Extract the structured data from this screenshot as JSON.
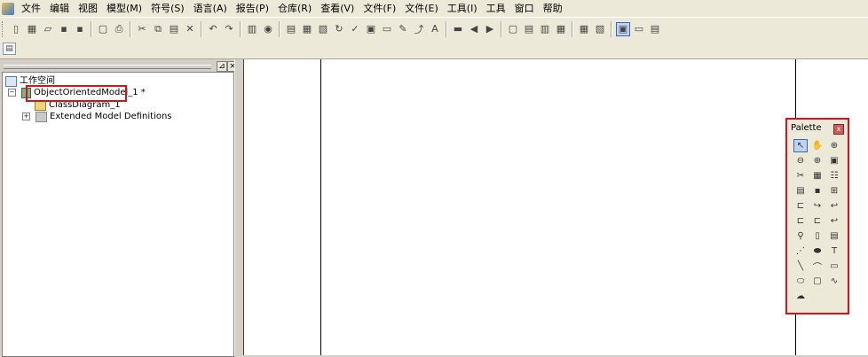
{
  "menubar": {
    "items": [
      "文件",
      "编辑",
      "视图",
      "模型(M)",
      "符号(S)",
      "语言(A)",
      "报告(P)",
      "仓库(R)",
      "查看(V)",
      "文件(F)",
      "文件(E)",
      "工具(I)",
      "工具",
      "窗口",
      "帮助"
    ]
  },
  "toolbar1": {
    "icons": [
      "new-icon",
      "open-model-icon",
      "open-icon",
      "save-icon",
      "save-all-icon",
      "print-preview-icon",
      "print-icon",
      "cut-icon",
      "copy-icon",
      "paste-icon",
      "delete-icon",
      "undo-icon",
      "redo-icon",
      "properties-icon",
      "browser-icon",
      "model-icon",
      "package-icon",
      "import-icon",
      "refresh-icon",
      "check-model-icon",
      "view-icon",
      "sheet-icon",
      "pencil-icon",
      "link-icon",
      "text-icon",
      "block-icon",
      "arrow-left-icon",
      "arrow-right-icon",
      "layout1-icon",
      "layout2-icon",
      "layout3-icon",
      "layout4-icon",
      "grid-icon",
      "zoom-fit-icon",
      "toggle-browser-icon",
      "toggle-output-icon",
      "toggle-result-icon"
    ]
  },
  "tree": {
    "root_label": "工作空间",
    "model_label": "ObjectOrientedModel_1 *",
    "diagram_label": "ClassDiagram_1",
    "ext_label": "Extended Model Definitions"
  },
  "panel": {
    "pin_glyph": "⊿",
    "close_glyph": "×"
  },
  "palette": {
    "title": "Palette",
    "close_glyph": "x",
    "tools": [
      {
        "name": "pointer-tool",
        "glyph": "↖",
        "selected": true
      },
      {
        "name": "grabber-tool",
        "glyph": "✋"
      },
      {
        "name": "zoom-in-tool",
        "glyph": "⊕"
      },
      {
        "name": "zoom-out-tool",
        "glyph": "⊖"
      },
      {
        "name": "zoom-tool",
        "glyph": "⊕"
      },
      {
        "name": "open-diagram-tool",
        "glyph": "▣"
      },
      {
        "name": "delete-tool",
        "glyph": "✂"
      },
      {
        "name": "properties-tool",
        "glyph": "▦"
      },
      {
        "name": "class-tool",
        "glyph": "☷"
      },
      {
        "name": "interface-tool",
        "glyph": "▤"
      },
      {
        "name": "port-tool",
        "glyph": "▪"
      },
      {
        "name": "package-tool",
        "glyph": "⊞"
      },
      {
        "name": "generalization-tool",
        "glyph": "⊏"
      },
      {
        "name": "association-tool",
        "glyph": "↪"
      },
      {
        "name": "aggregation-tool",
        "glyph": "↩"
      },
      {
        "name": "composition-tool",
        "glyph": "⊏"
      },
      {
        "name": "dependency-tool",
        "glyph": "⊏"
      },
      {
        "name": "realization-tool",
        "glyph": "↩"
      },
      {
        "name": "require-link-tool",
        "glyph": "⚲"
      },
      {
        "name": "file-tool",
        "glyph": "▯"
      },
      {
        "name": "note-tool",
        "glyph": "▤"
      },
      {
        "name": "link-tool",
        "glyph": "⋰"
      },
      {
        "name": "title-tool",
        "glyph": "⬬"
      },
      {
        "name": "text-tool",
        "glyph": "T"
      },
      {
        "name": "line-tool",
        "glyph": "╲"
      },
      {
        "name": "arc-tool",
        "glyph": "⌒"
      },
      {
        "name": "rectangle-tool",
        "glyph": "▭"
      },
      {
        "name": "ellipse-tool",
        "glyph": "⬭"
      },
      {
        "name": "rounded-rect-tool",
        "glyph": "▢"
      },
      {
        "name": "polyline-tool",
        "glyph": "∿"
      },
      {
        "name": "polygon-tool",
        "glyph": "☁"
      }
    ]
  },
  "colors": {
    "highlight": "#d4141a",
    "chrome": "#ece9d8",
    "selection": "#c1d2ee"
  }
}
